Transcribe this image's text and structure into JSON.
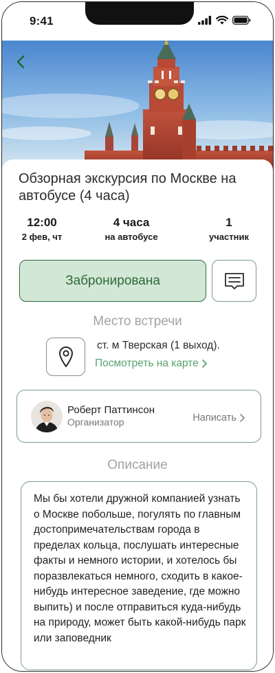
{
  "status_bar": {
    "time": "9:41"
  },
  "tour": {
    "title": "Обзорная экскурсия по Москве на автобусе (4 часа)",
    "time": "12:00",
    "date": "2 фев, чт",
    "duration": "4 часа",
    "transport": "на автобусе",
    "participants_count": "1",
    "participants_label": "участник"
  },
  "actions": {
    "booked_label": "Забронирована",
    "chat_icon": "message-icon"
  },
  "meeting": {
    "section_title": "Место встречи",
    "address": "ст. м Тверская (1 выход).",
    "map_link": "Посмотреть на карте"
  },
  "organizer": {
    "name": "Роберт Паттинсон",
    "role": "Организатор",
    "write_label": "Написать"
  },
  "description": {
    "section_title": "Описание",
    "text": "Мы бы хотели дружной компанией узнать о Москве побольше, погулять по главным достопримечательствам города в пределах кольца, послушать интересные факты и немного истории, и хотелось бы поразвлекаться немного, сходить в какое-нибудь интересное заведение, где можно выпить) и после отправиться куда-нибудь на природу, может быть какой-нибудь парк или заповедник"
  },
  "colors": {
    "accent": "#2e6b3e",
    "accent_light": "#d3e7d6",
    "link": "#57a36d",
    "muted": "#a2a2a2"
  }
}
